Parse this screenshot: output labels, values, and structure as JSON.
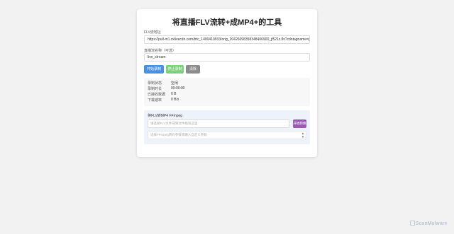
{
  "app": {
    "title": "将直播FLV流转+成MP4+的工具"
  },
  "flv_url": {
    "label": "FLV流地址",
    "value": "https://pull-m1.xxlivecdn.com/trtc_1400419933/orig_20426698358348406900_jf521z.flv?cdntagname=jf521z&"
  },
  "stream_name": {
    "label": "直播流名称（可选）",
    "value": "live_stream"
  },
  "buttons": {
    "start": "开始录制FLV",
    "stop": "停止录制",
    "clear": "清除"
  },
  "stats": [
    {
      "label": "录制状态",
      "value": "空闲"
    },
    {
      "label": "录制时长",
      "value": "00:00:00"
    },
    {
      "label": "已接收数据",
      "value": "0 B"
    },
    {
      "label": "下载速率",
      "value": "0 B/s"
    }
  ],
  "converter": {
    "title": "将FLV转MP4 FFmpeg",
    "input_placeholder": "请选择FLV文件或将文件拖到这里",
    "button": "开始转换",
    "select_placeholder": "选择FFmpeg转码参数或输入自定义参数"
  },
  "watermark": "ScanMalware"
}
